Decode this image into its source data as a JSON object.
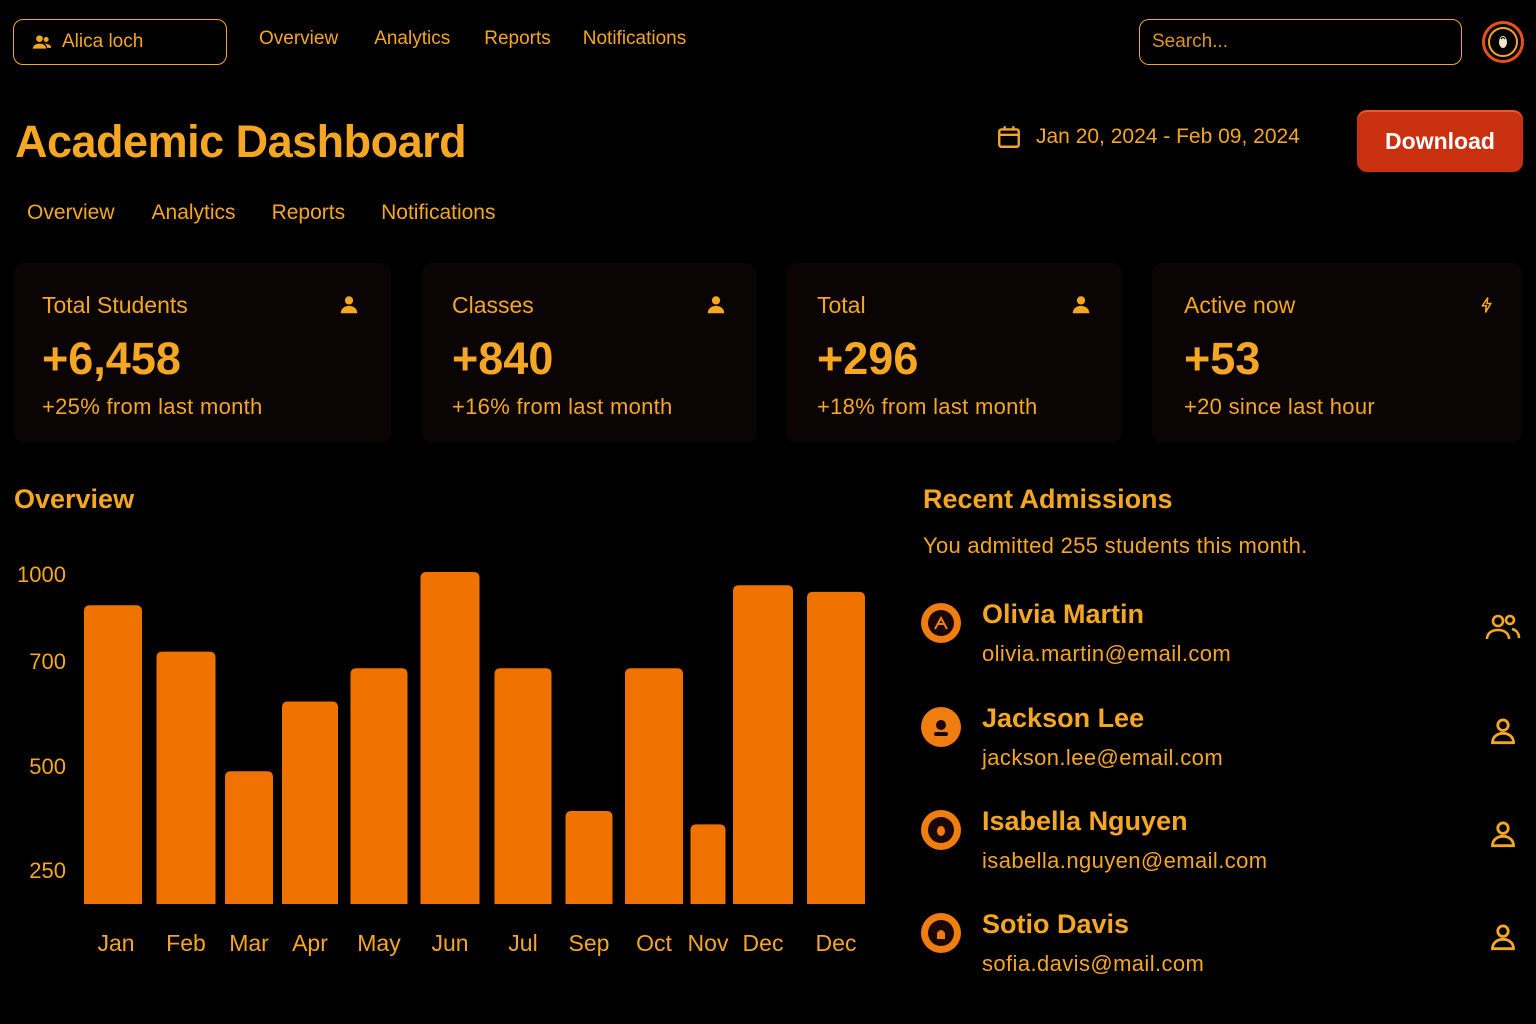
{
  "topbar": {
    "user_name": "Alica loch",
    "nav": [
      "Overview",
      "Analytics",
      "Reports",
      "Notifications"
    ],
    "search_placeholder": "Search..."
  },
  "header": {
    "title": "Academic Dashboard",
    "date_range": "Jan 20, 2024 - Feb 09, 2024",
    "download_label": "Download"
  },
  "tabs": [
    "Overview",
    "Analytics",
    "Reports",
    "Notifications"
  ],
  "stats": [
    {
      "label": "Total Students",
      "value": "+6,458",
      "delta": "+25% from last month",
      "icon": "user-icon"
    },
    {
      "label": "Classes",
      "value": "+840",
      "delta": "+16% from last month",
      "icon": "user-icon"
    },
    {
      "label": "Total",
      "value": "+296",
      "delta": "+18% from last month",
      "icon": "user-icon"
    },
    {
      "label": "Active now",
      "value": "+53",
      "delta": "+20 since last hour",
      "icon": "bolt-icon"
    }
  ],
  "overview": {
    "title": "Overview"
  },
  "chart_data": {
    "type": "bar",
    "categories": [
      "Jan",
      "Feb",
      "Mar",
      "Apr",
      "May",
      "Jun",
      "Jul",
      "Sep",
      "Oct",
      "Nov",
      "Dec",
      "Dec"
    ],
    "values": [
      900,
      760,
      400,
      610,
      710,
      1000,
      710,
      280,
      710,
      240,
      960,
      940
    ],
    "yticks": [
      "1000",
      "700",
      "500",
      "250"
    ],
    "color": "#f07200"
  },
  "recent": {
    "title": "Recent Admissions",
    "subtitle": "You admitted 255 students this month.",
    "items": [
      {
        "name": "Olivia Martin",
        "email": "olivia.martin@email.com",
        "action_icon": "users-icon"
      },
      {
        "name": "Jackson Lee",
        "email": "jackson.lee@email.com",
        "action_icon": "user-icon"
      },
      {
        "name": "Isabella Nguyen",
        "email": "isabella.nguyen@email.com",
        "action_icon": "user-icon"
      },
      {
        "name": "Sotio Davis",
        "email": "sofia.davis@mail.com",
        "action_icon": "user-icon"
      }
    ]
  },
  "colors": {
    "accent": "#f5a623",
    "bar": "#f07200",
    "button": "#c8300f",
    "card_bg": "#0b0404",
    "background": "#000000"
  }
}
